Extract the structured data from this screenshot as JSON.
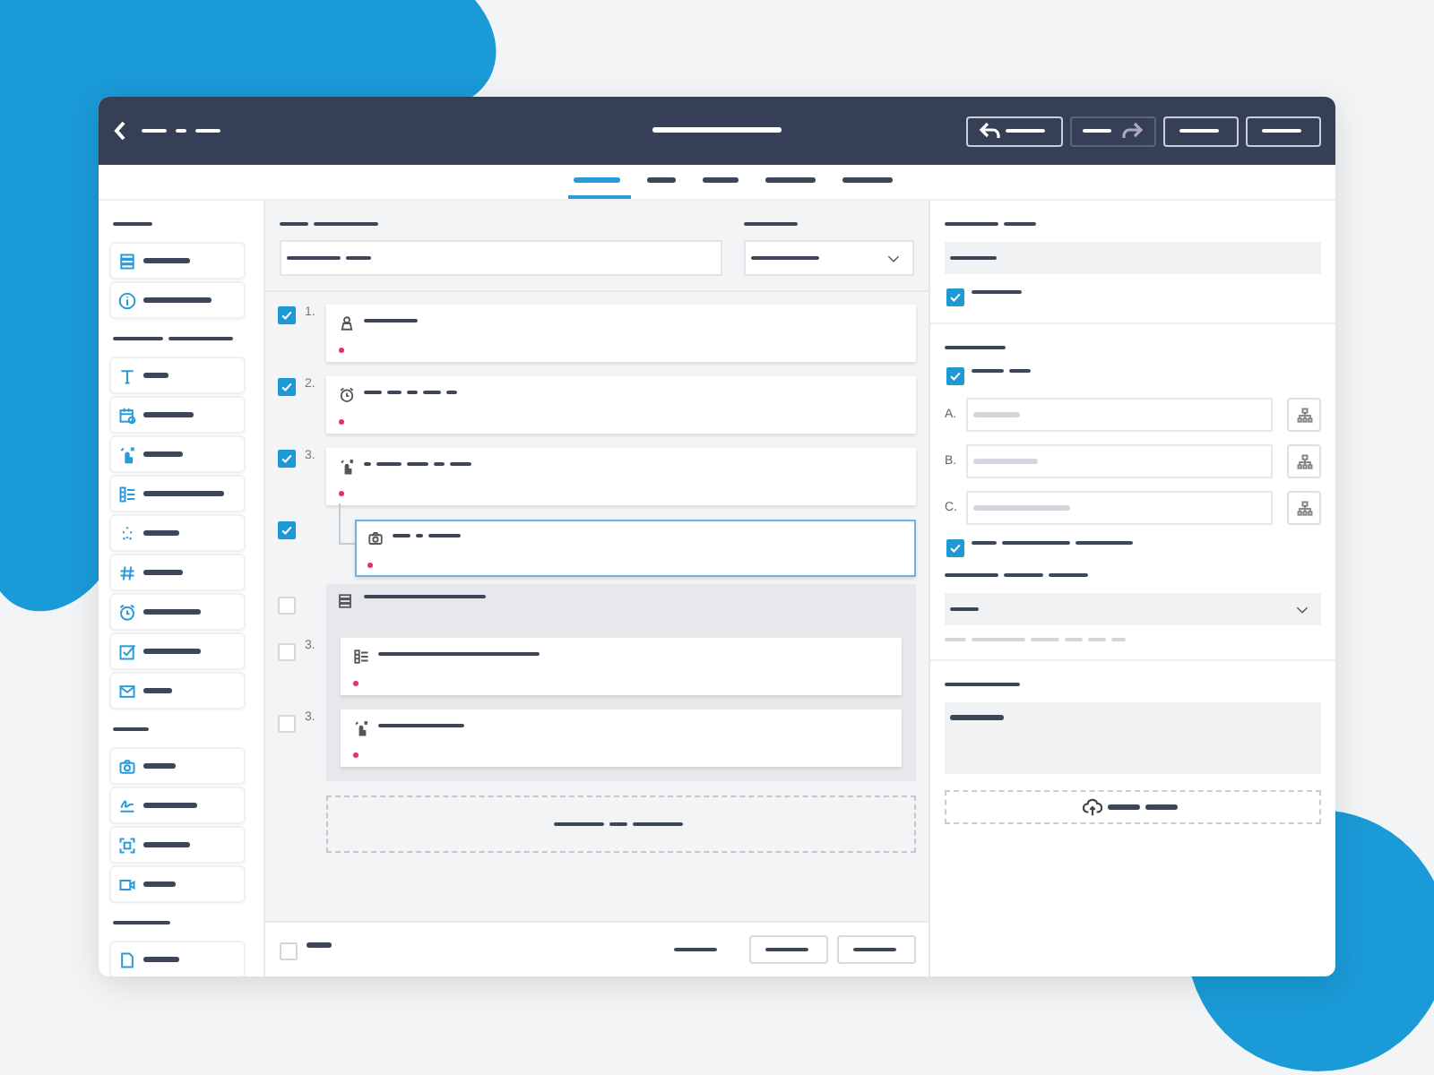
{
  "tabs": [
    {
      "selected": true
    },
    {
      "selected": false
    },
    {
      "selected": false
    },
    {
      "selected": false
    },
    {
      "selected": false
    }
  ],
  "questions": [
    {
      "kind": "question",
      "number": "1.",
      "checked": true,
      "selected": false
    },
    {
      "kind": "question",
      "number": "2.",
      "checked": true,
      "selected": false
    },
    {
      "kind": "question",
      "number": "3.",
      "checked": true,
      "selected": false
    },
    {
      "kind": "nested",
      "checked": true,
      "selected": true
    },
    {
      "kind": "group",
      "checked": false,
      "selected": false,
      "children": [
        {
          "number": "3.",
          "checked": false,
          "selected": false
        },
        {
          "number": "3.",
          "checked": false,
          "selected": false
        }
      ]
    }
  ],
  "footer": {
    "select_all": {
      "checked": false
    }
  },
  "settings": {
    "required": {
      "checked": true
    },
    "options_enabled": {
      "checked": true
    },
    "options": [
      {
        "letter": "A."
      },
      {
        "letter": "B."
      },
      {
        "letter": "C."
      }
    ],
    "randomize": {
      "checked": true
    }
  }
}
